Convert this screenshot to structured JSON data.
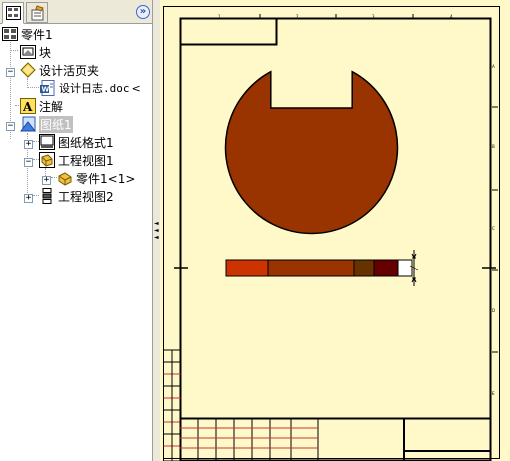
{
  "panel": {
    "tabs": [
      {
        "name": "feature-tree",
        "icon": "feature-tree-icon",
        "active": true
      },
      {
        "name": "properties",
        "icon": "properties-icon",
        "active": false
      }
    ],
    "expand_symbol": "»"
  },
  "tree": {
    "root": {
      "label": "零件1",
      "icon": "part-icon"
    },
    "items": [
      {
        "label": "块",
        "icon": "block-icon"
      },
      {
        "label": "设计活页夹",
        "icon": "design-binder-icon",
        "expanded": true
      },
      {
        "label": "设计日志.doc  ",
        "icon": "word-document-icon"
      },
      {
        "label": "注解",
        "icon": "annotation-icon"
      },
      {
        "label": "图纸1",
        "icon": "sheet-icon",
        "expanded": true,
        "selected": true
      },
      {
        "label": "图纸格式1",
        "icon": "sheet-format-icon",
        "expanded": false
      },
      {
        "label": "工程视图1",
        "icon": "drawing-view-icon",
        "expanded": true
      },
      {
        "label": "零件1<1>",
        "icon": "part-instance-icon",
        "expanded": false
      },
      {
        "label": "工程视图2",
        "icon": "drawing-view-icon",
        "expanded": false
      }
    ],
    "expander_plus": "+",
    "expander_minus": "−"
  },
  "splitter": {
    "arrows": "◄◄◄"
  },
  "drawing": {
    "background_color": "#fff8c8",
    "part_color": "#993300",
    "zone_letters": [
      "A",
      "B",
      "C",
      "D",
      "E"
    ],
    "zone_numbers": [
      "1",
      "2",
      "3",
      "4"
    ],
    "section_view_segment_colors": [
      "#cc3300",
      "#993300",
      "#993300",
      "#663300",
      "#660000",
      "#ffffff"
    ]
  }
}
